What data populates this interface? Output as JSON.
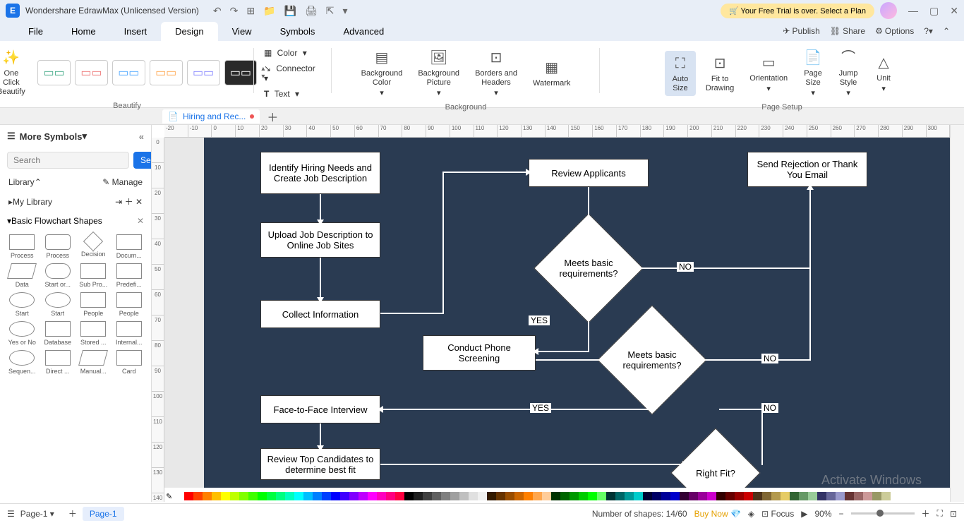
{
  "title": "Wondershare EdrawMax (Unlicensed Version)",
  "trial_banner": "Your Free Trial is over. Select a Plan",
  "menu": {
    "file": "File",
    "home": "Home",
    "insert": "Insert",
    "design": "Design",
    "view": "View",
    "symbols": "Symbols",
    "advanced": "Advanced"
  },
  "menu_right": {
    "publish": "Publish",
    "share": "Share",
    "options": "Options"
  },
  "ribbon": {
    "one_click": "One Click\nBeautify",
    "beautify_label": "Beautify",
    "color": "Color",
    "connector": "Connector",
    "text": "Text",
    "bg_color": "Background\nColor",
    "bg_picture": "Background\nPicture",
    "borders": "Borders and\nHeaders",
    "watermark": "Watermark",
    "background_label": "Background",
    "auto_size": "Auto\nSize",
    "fit_drawing": "Fit to\nDrawing",
    "orientation": "Orientation",
    "page_size": "Page\nSize",
    "jump_style": "Jump\nStyle",
    "unit": "Unit",
    "page_setup_label": "Page Setup"
  },
  "doc_tab": "Hiring and Rec...",
  "left": {
    "more_symbols": "More Symbols",
    "search_placeholder": "Search",
    "search_btn": "Search",
    "library": "Library",
    "manage": "Manage",
    "my_library": "My Library",
    "basic_shapes": "Basic Flowchart Shapes",
    "shapes": [
      "Process",
      "Process",
      "Decision",
      "Docum...",
      "Data",
      "Start or...",
      "Sub Pro...",
      "Predefi...",
      "Start",
      "Start",
      "People",
      "People",
      "Yes or No",
      "Database",
      "Stored ...",
      "Internal...",
      "Sequen...",
      "Direct ...",
      "Manual...",
      "Card"
    ]
  },
  "ruler_h": [
    "-20",
    "-10",
    "0",
    "10",
    "20",
    "30",
    "40",
    "50",
    "60",
    "70",
    "80",
    "90",
    "100",
    "110",
    "120",
    "130",
    "140",
    "150",
    "160",
    "170",
    "180",
    "190",
    "200",
    "210",
    "220",
    "230",
    "240",
    "250",
    "260",
    "270",
    "280",
    "290",
    "300"
  ],
  "ruler_v": [
    "0",
    "10",
    "20",
    "30",
    "40",
    "50",
    "60",
    "70",
    "80",
    "90",
    "100",
    "110",
    "120",
    "130",
    "140"
  ],
  "flow": {
    "b1": "Identify Hiring Needs and Create Job Description",
    "b2": "Upload Job Description to Online Job Sites",
    "b3": "Collect Information",
    "b4": "Review Applicants",
    "b5": "Send Rejection or Thank You Email",
    "d1": "Meets basic requirements?",
    "b6": "Conduct Phone Screening",
    "d2": "Meets basic requirements?",
    "b7": "Face-to-Face Interview",
    "b8": "Review Top Candidates to determine best fit",
    "d3": "Right Fit?",
    "yes": "YES",
    "no": "NO"
  },
  "status": {
    "page_select": "Page-1",
    "page_tab": "Page-1",
    "shapes": "Number of shapes: 14/60",
    "buy": "Buy Now",
    "focus": "Focus",
    "zoom": "90%"
  },
  "watermark": "Activate Windows",
  "colors": [
    "#ffffff",
    "#ff0000",
    "#ff4000",
    "#ff8000",
    "#ffbf00",
    "#ffff00",
    "#bfff00",
    "#80ff00",
    "#40ff00",
    "#00ff00",
    "#00ff40",
    "#00ff80",
    "#00ffbf",
    "#00ffff",
    "#00bfff",
    "#0080ff",
    "#0040ff",
    "#0000ff",
    "#4000ff",
    "#8000ff",
    "#bf00ff",
    "#ff00ff",
    "#ff00bf",
    "#ff0080",
    "#ff0040",
    "#000000",
    "#202020",
    "#404040",
    "#606060",
    "#808080",
    "#a0a0a0",
    "#c0c0c0",
    "#e0e0e0",
    "#f0f0f0",
    "#331a00",
    "#663300",
    "#994d00",
    "#cc6600",
    "#ff8000",
    "#ffa64d",
    "#ffcc99",
    "#003300",
    "#006600",
    "#009900",
    "#00cc00",
    "#00ff00",
    "#66ff66",
    "#003333",
    "#006666",
    "#009999",
    "#00cccc",
    "#000033",
    "#000066",
    "#000099",
    "#0000cc",
    "#330033",
    "#660066",
    "#990099",
    "#cc00cc",
    "#330000",
    "#660000",
    "#990000",
    "#cc0000",
    "#4d3319",
    "#806633",
    "#b3994d",
    "#e6cc66",
    "#336633",
    "#669966",
    "#99cc99",
    "#333366",
    "#666699",
    "#9999cc",
    "#663333",
    "#996666",
    "#cc9999",
    "#999966",
    "#cccc99"
  ]
}
